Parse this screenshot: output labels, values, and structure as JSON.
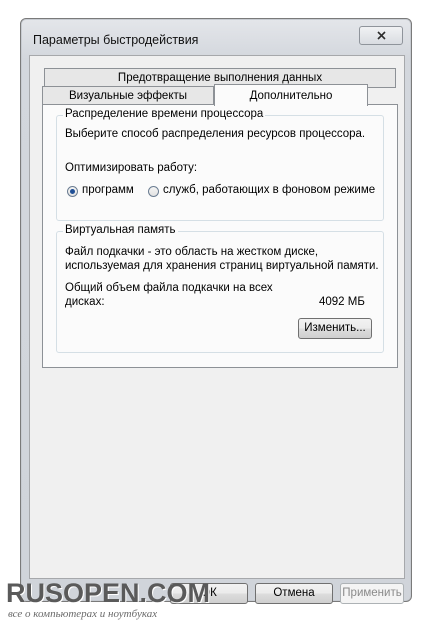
{
  "window": {
    "title": "Параметры быстродействия"
  },
  "tabs": {
    "row1": "Предотвращение выполнения данных",
    "visual": "Визуальные эффекты",
    "active": "Дополнительно"
  },
  "cpu": {
    "legend": "Распределение времени процессора",
    "description": "Выберите способ распределения ресурсов процессора.",
    "optimize_label": "Оптимизировать работу:",
    "options": [
      {
        "label": "программ",
        "checked": true
      },
      {
        "label": "служб, работающих в фоновом режиме",
        "checked": false
      }
    ]
  },
  "vm": {
    "legend": "Виртуальная память",
    "desc_line1": "Файл подкачки - это область на жестком диске,",
    "desc_line2": "используемая для хранения страниц виртуальной памяти.",
    "total_line1": "Общий объем файла подкачки на всех",
    "total_line2": "дисках:",
    "total_value": "4092 МБ",
    "change_button": "Изменить..."
  },
  "footer": {
    "ok": "ОК",
    "cancel": "Отмена",
    "apply": "Применить"
  },
  "watermark": {
    "logo": "RUSOPEN.COM",
    "tagline": "все о компьютерах и ноутбуках"
  }
}
